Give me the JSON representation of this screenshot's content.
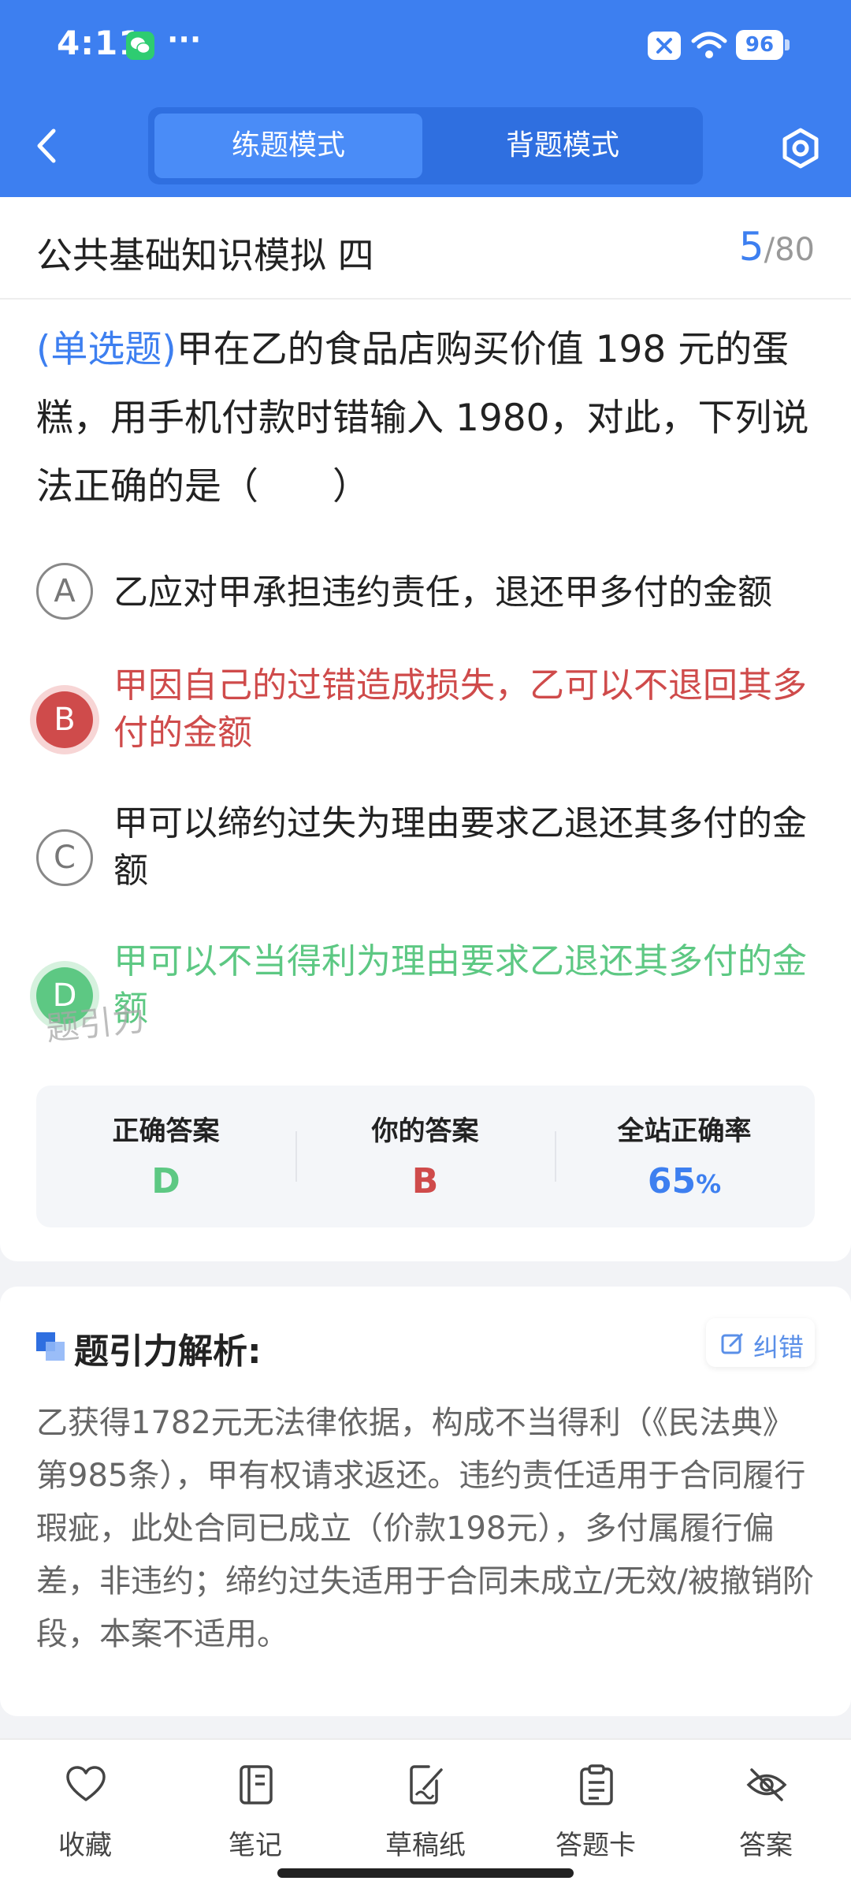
{
  "status_bar": {
    "time": "4:11",
    "more": "···",
    "battery": "96"
  },
  "header": {
    "tabs": [
      {
        "label": "练题模式"
      },
      {
        "label": "背题模式"
      }
    ]
  },
  "question": {
    "title": "公共基础知识模拟 四",
    "current": "5",
    "separator": "/",
    "total": "80",
    "type": "(单选题)",
    "text": "甲在乙的食品店购买价值 198 元的蛋糕，用手机付款时错输入 1980，对此，下列说法正确的是（　　）",
    "options": [
      {
        "letter": "A",
        "text": "乙应对甲承担违约责任，退还甲多付的金额"
      },
      {
        "letter": "B",
        "text": "甲因自己的过错造成损失，乙可以不退回其多付的金额"
      },
      {
        "letter": "C",
        "text": "甲可以缔约过失为理由要求乙退还其多付的金额"
      },
      {
        "letter": "D",
        "text": "甲可以不当得利为理由要求乙退还其多付的金额"
      }
    ],
    "watermark": "题引力"
  },
  "summary": {
    "correct_label": "正确答案",
    "correct_value": "D",
    "yours_label": "你的答案",
    "yours_value": "B",
    "rate_label": "全站正确率",
    "rate_value": "65",
    "rate_unit": "%"
  },
  "analysis": {
    "title": "题引力解析:",
    "correction_label": "纠错",
    "text": "乙获得1782元无法律依据，构成不当得利（《民法典》第985条），甲有权请求返还。违约责任适用于合同履行瑕疵，此处合同已成立（价款198元），多付属履行偏差，非违约；缔约过失适用于合同未成立/无效/被撤销阶段，本案不适用。"
  },
  "bottom_nav": [
    {
      "label": "收藏",
      "icon": "heart-icon"
    },
    {
      "label": "笔记",
      "icon": "notebook-icon"
    },
    {
      "label": "草稿纸",
      "icon": "draft-icon"
    },
    {
      "label": "答题卡",
      "icon": "clipboard-icon"
    },
    {
      "label": "答案",
      "icon": "eye-off-icon"
    }
  ],
  "colors": {
    "primary": "#3d7ff0",
    "wrong": "#cf4b4b",
    "right": "#5dc883"
  }
}
